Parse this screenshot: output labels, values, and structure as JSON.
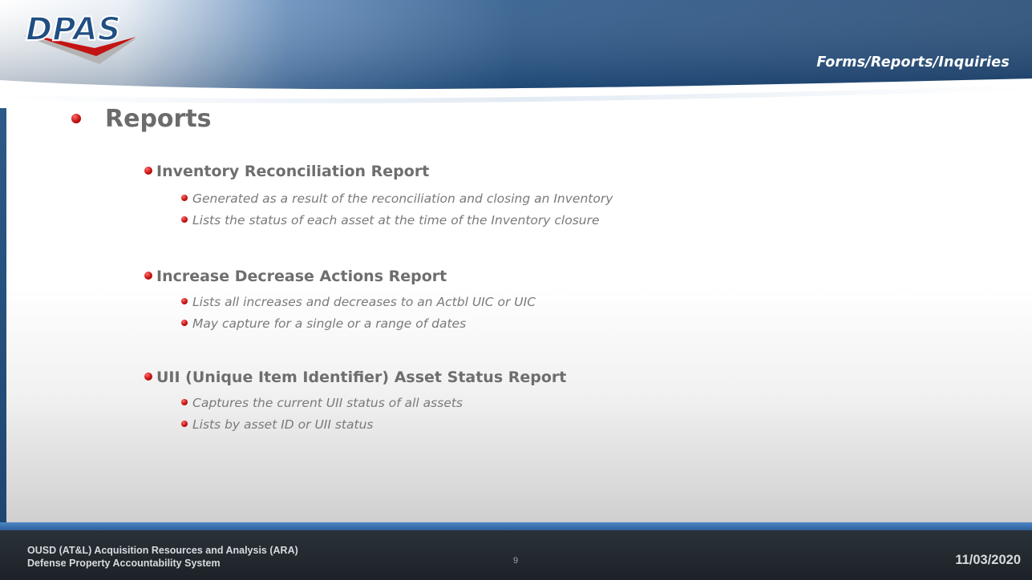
{
  "header": {
    "logo_text": "DPAS",
    "section_title": "Forms/Reports/Inquiries"
  },
  "main": {
    "heading": "Reports",
    "groups": [
      {
        "title": "Inventory Reconciliation Report",
        "items": [
          "Generated as a result of the reconciliation and closing an Inventory",
          "Lists the status of each asset at the time of the Inventory closure"
        ]
      },
      {
        "title": "Increase Decrease Actions Report",
        "items": [
          "Lists all increases and decreases to an Actbl UIC or UIC",
          "May capture for a single or a range of dates"
        ]
      },
      {
        "title": "UII (Unique Item Identifier) Asset Status Report",
        "items": [
          "Captures the current UII status of all assets",
          "Lists by asset ID or UII status"
        ]
      }
    ]
  },
  "footer": {
    "org_line1": "OUSD (AT&L) Acquisition Resources and Analysis (ARA)",
    "org_line2": "Defense Property Accountability System",
    "page_number": "9",
    "date": "11/03/2020"
  },
  "colors": {
    "header_blue": "#1f4e82",
    "bullet_red": "#c41313",
    "text_gray": "#6e6e6e",
    "footer_dark": "#22292f"
  }
}
